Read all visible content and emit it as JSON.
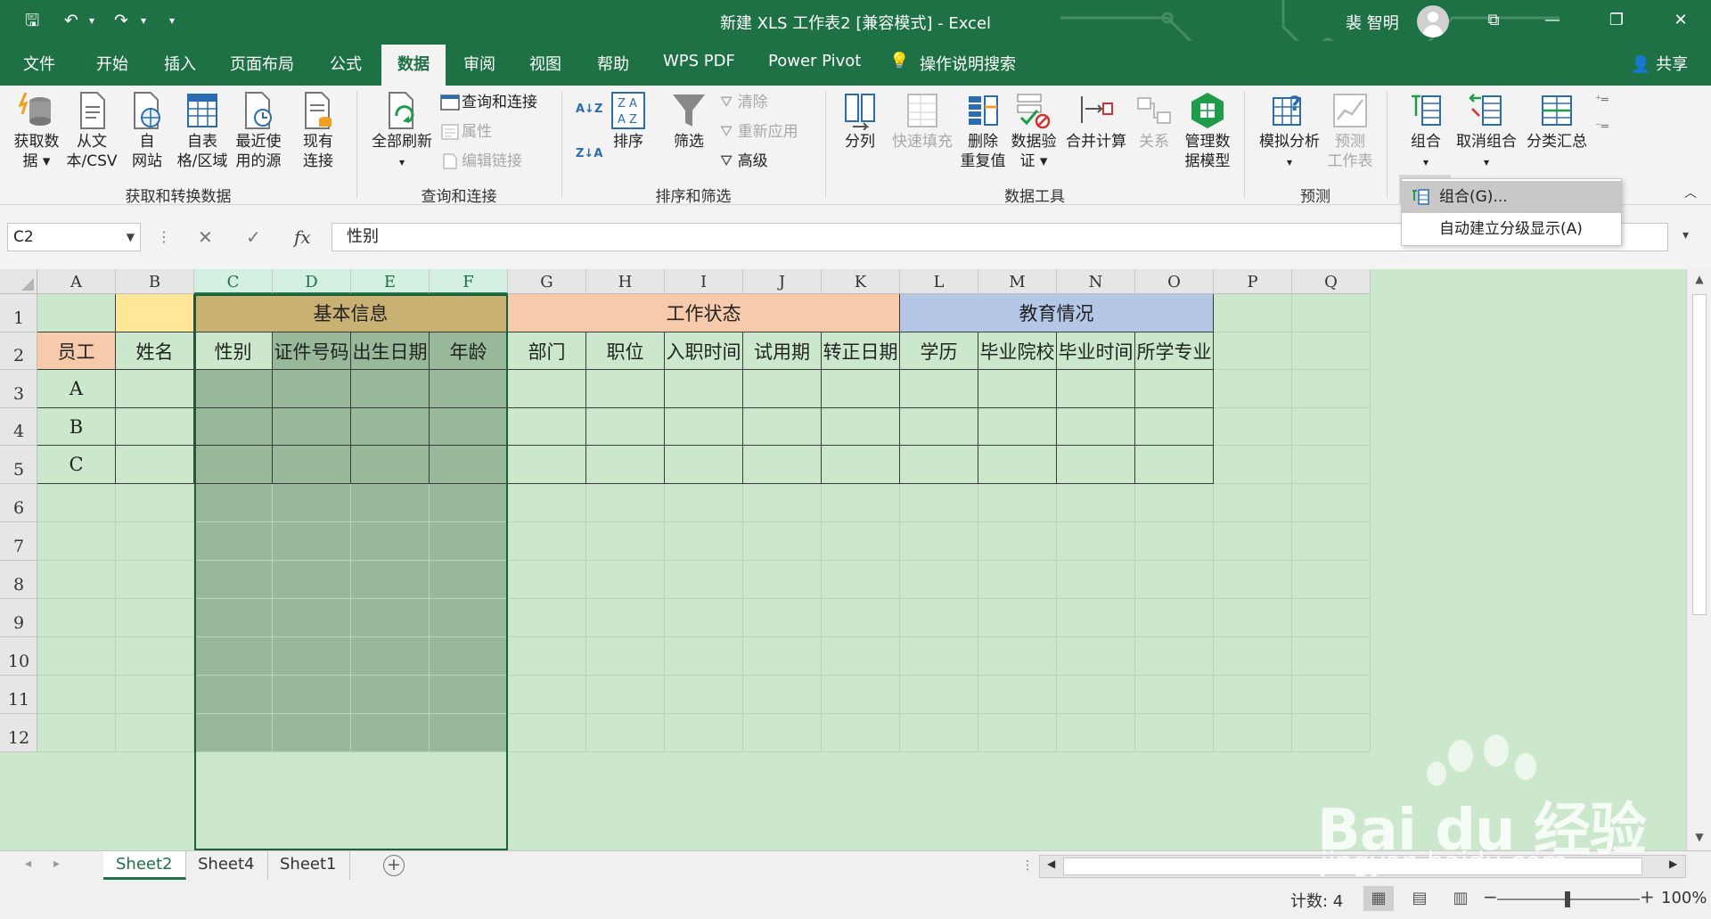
{
  "window": {
    "title": "新建 XLS 工作表2 [兼容模式] - Excel",
    "user": "裴 智明",
    "qa_save": "🖫",
    "qa_undo": "↶",
    "qa_redo": "↷",
    "qa_more": "▾",
    "btn_ribbon_display": "⧉",
    "btn_minimize": "—",
    "btn_restore": "❐",
    "btn_close": "✕"
  },
  "tabs": [
    "文件",
    "开始",
    "插入",
    "页面布局",
    "公式",
    "数据",
    "审阅",
    "视图",
    "帮助",
    "WPS PDF",
    "Power Pivot",
    "操作说明搜索"
  ],
  "active_tab": "数据",
  "share": "共享",
  "ribbon": {
    "get_data": [
      "获取数",
      "据 ▾"
    ],
    "from_csv": [
      "从文",
      "本/CSV"
    ],
    "from_web": [
      "自",
      "网站"
    ],
    "from_table": [
      "自表",
      "格/区域"
    ],
    "recent_sources": [
      "最近使",
      "用的源"
    ],
    "existing_conn": [
      "现有",
      "连接"
    ],
    "group_get_transform": "获取和转换数据",
    "refresh_all": [
      "全部刷新",
      "▾"
    ],
    "queries_connections": "查询和连接",
    "properties": "属性",
    "edit_links": "编辑链接",
    "group_queries": "查询和连接",
    "sort_az": "A↓Z",
    "sort_za": "Z↓A",
    "sort": "排序",
    "filter": "筛选",
    "clear": "清除",
    "reapply": "重新应用",
    "advanced": "高级",
    "group_sort_filter": "排序和筛选",
    "text_to_columns": "分列",
    "flash_fill": "快速填充",
    "remove_dup": [
      "删除",
      "重复值"
    ],
    "data_validation": [
      "数据验",
      "证 ▾"
    ],
    "consolidate": "合并计算",
    "relationships": "关系",
    "data_model": [
      "管理数",
      "据模型"
    ],
    "group_data_tools": "数据工具",
    "what_if": [
      "模拟分析",
      "▾"
    ],
    "forecast_sheet": [
      "预测",
      "工作表"
    ],
    "group_forecast": "预测",
    "group_btn": [
      "组合",
      "▾"
    ],
    "ungroup": [
      "取消组合",
      "▾"
    ],
    "subtotal": "分类汇总",
    "collapse": "︿"
  },
  "dropdown": {
    "item1": "组合(G)...",
    "item2": "自动建立分级显示(A)"
  },
  "formula_bar": {
    "name_box": "C2",
    "formula": "性别",
    "fx": "fx",
    "cancel": "✕",
    "enter": "✓",
    "dots": "⋮"
  },
  "columns": [
    "A",
    "B",
    "C",
    "D",
    "E",
    "F",
    "G",
    "H",
    "I",
    "J",
    "K",
    "L",
    "M",
    "N",
    "O",
    "P",
    "Q"
  ],
  "rows": [
    "1",
    "2",
    "3",
    "4",
    "5",
    "6",
    "7",
    "8",
    "9",
    "10",
    "11",
    "12"
  ],
  "cells": {
    "A2": "员工",
    "A3": "A",
    "A4": "B",
    "A5": "C",
    "B2": "姓名",
    "C1": "基本信息",
    "G1": "工作状态",
    "L1": "教育情况",
    "C2": "性别",
    "D2": "证件号码",
    "E2": "出生日期",
    "F2": "年龄",
    "G2": "部门",
    "H2": "职位",
    "I2": "入职时间",
    "J2": "试用期",
    "K2": "转正日期",
    "L2": "学历",
    "M2": "毕业院校",
    "N2": "毕业时间",
    "O2": "所学专业"
  },
  "colors": {
    "excel_green": "#1e7145",
    "sheet_bg": "#cce8cc",
    "header_salmon": "#f7caac",
    "header_yellow": "#ffe699",
    "header_gold": "#c9b173",
    "header_blue": "#b4c7e7",
    "selection_fill": "#98b89a"
  },
  "sheets": [
    "Sheet2",
    "Sheet4",
    "Sheet1"
  ],
  "active_sheet": "Sheet2",
  "status": {
    "count": "计数: 4",
    "zoom": "100%",
    "minus": "−",
    "plus": "+"
  },
  "watermark": {
    "text": "Bai du 经验",
    "url": "jingyan.baidu.com"
  }
}
